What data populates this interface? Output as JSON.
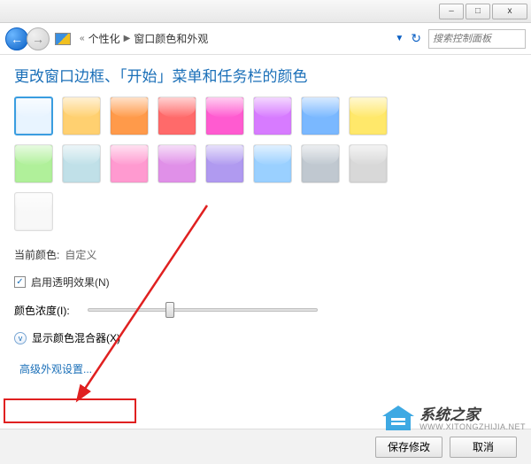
{
  "titlebar": {
    "min": "–",
    "max": "□",
    "close": "x"
  },
  "nav": {
    "crumb1": "个性化",
    "crumb2": "窗口颜色和外观",
    "search_placeholder": "搜索控制面板"
  },
  "heading": "更改窗口边框、「开始」菜单和任务栏的颜色",
  "swatches": [
    "#e8f4ff",
    "#ffd070",
    "#ff9a4a",
    "#ff6a6a",
    "#ff5bd0",
    "#d77bff",
    "#7ab8ff",
    "#ffe86a",
    "#b0f09a",
    "#c0e0e8",
    "#ff9ad0",
    "#e090e8",
    "#b09af0",
    "#9ad0ff",
    "#c0c8d0",
    "#d8d8d8",
    "#f8f8f8"
  ],
  "current_color": {
    "label": "当前颜色:",
    "value": "自定义"
  },
  "transparency": {
    "checked": true,
    "label": "启用透明效果(N)"
  },
  "intensity": {
    "label": "颜色浓度(I):"
  },
  "mixer": {
    "label": "显示颜色混合器(X)"
  },
  "advanced_link": "高级外观设置...",
  "footer": {
    "save": "保存修改",
    "cancel": "取消"
  },
  "watermark": {
    "title": "系统之家",
    "sub": "WWW.XITONGZHIJIA.NET"
  }
}
